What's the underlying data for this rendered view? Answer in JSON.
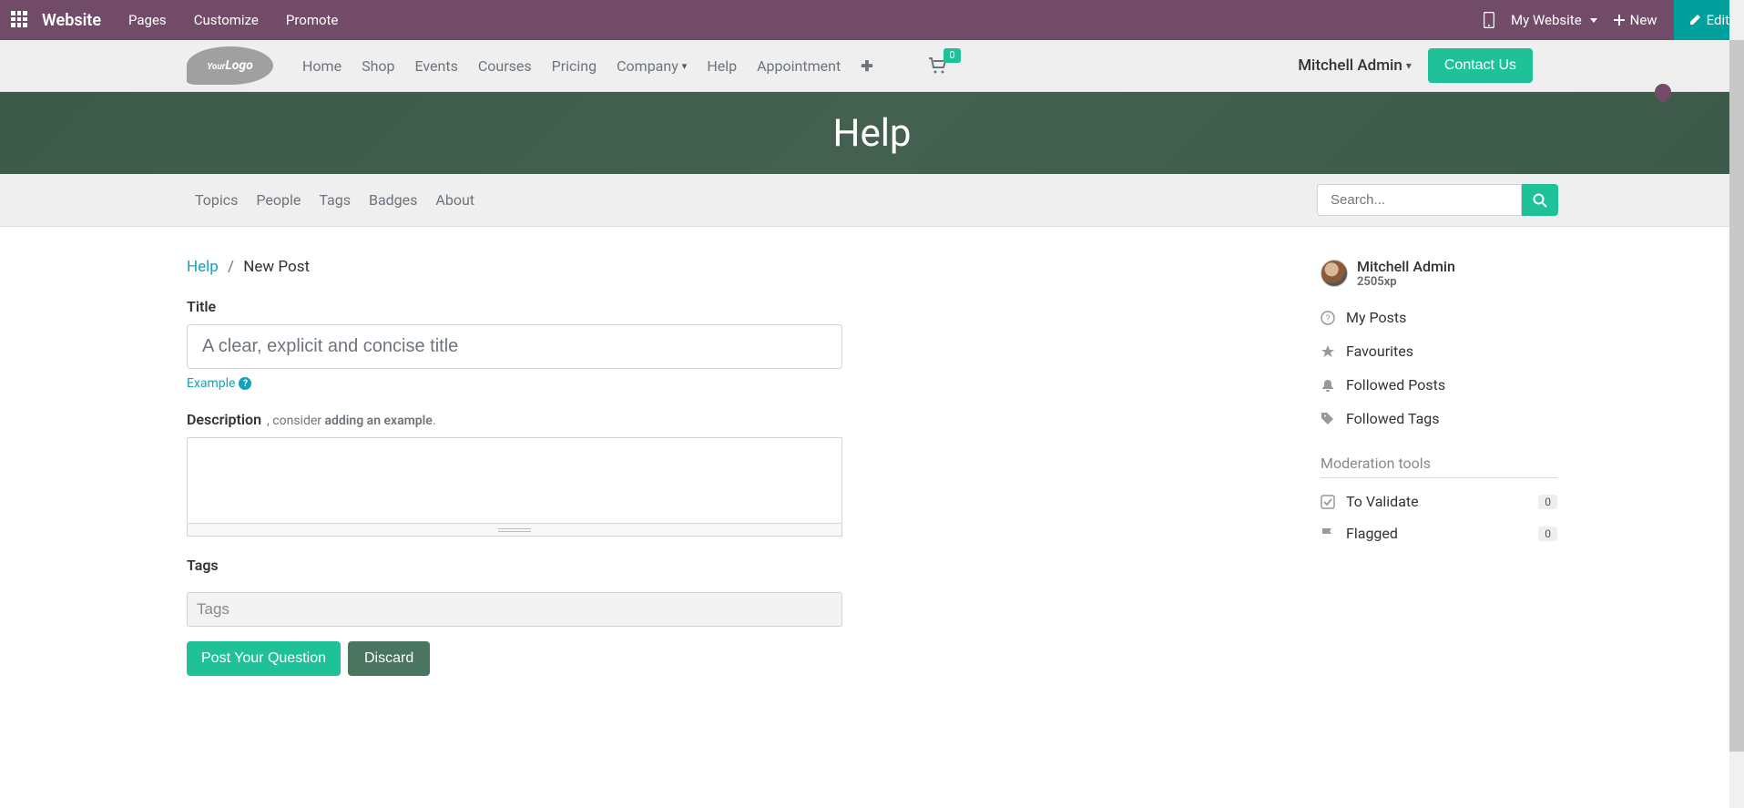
{
  "topbar": {
    "brand": "Website",
    "menu": [
      "Pages",
      "Customize",
      "Promote"
    ],
    "mobile_icon": "mobile-icon",
    "my_website": "My Website",
    "new_label": "New",
    "edit_label": "Edit"
  },
  "siteheader": {
    "logo_your": "Your",
    "logo_logo": "Logo",
    "nav": [
      "Home",
      "Shop",
      "Events",
      "Courses",
      "Pricing",
      "Company",
      "Help",
      "Appointment"
    ],
    "cart_count": "0",
    "user": "Mitchell Admin",
    "contact": "Contact Us"
  },
  "hero": {
    "title": "Help"
  },
  "subnav": {
    "tabs": [
      "Topics",
      "People",
      "Tags",
      "Badges",
      "About"
    ],
    "search_placeholder": "Search..."
  },
  "breadcrumb": {
    "root": "Help",
    "sep": "/",
    "current": "New Post"
  },
  "form": {
    "title_label": "Title",
    "title_placeholder": "A clear, explicit and concise title",
    "example_link": "Example",
    "desc_label": "Description",
    "desc_hint_prefix": ", consider ",
    "desc_hint_bold": "adding an example",
    "desc_hint_suffix": ".",
    "tags_label": "Tags",
    "tags_placeholder": "Tags",
    "post_btn": "Post Your Question",
    "discard_btn": "Discard"
  },
  "sidebar": {
    "user_name": "Mitchell Admin",
    "user_xp": "2505xp",
    "links": [
      "My Posts",
      "Favourites",
      "Followed Posts",
      "Followed Tags"
    ],
    "mod_title": "Moderation tools",
    "mod_links": [
      {
        "label": "To Validate",
        "count": "0"
      },
      {
        "label": "Flagged",
        "count": "0"
      }
    ]
  }
}
